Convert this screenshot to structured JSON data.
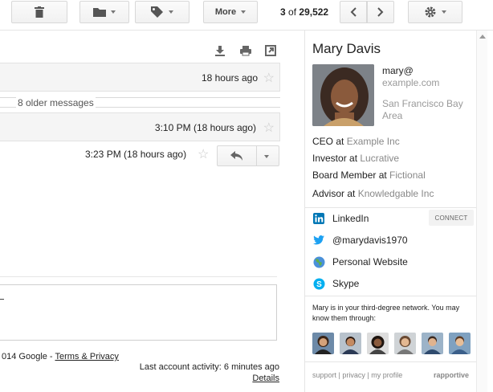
{
  "toolbar": {
    "buttons": [
      {
        "icon": "trash-icon"
      },
      {
        "icon": "folder-icon"
      },
      {
        "icon": "label-icon"
      }
    ],
    "more_label": "More",
    "pager": {
      "current": "3",
      "of_label": "of",
      "total": "29,522"
    },
    "settings_icon": "gear-icon"
  },
  "thread": {
    "util_icons": [
      "download-icon",
      "print-icon",
      "new-window-icon"
    ],
    "first_time": "18 hours ago",
    "older_messages": "8 older messages",
    "second_time": "3:10 PM (18 hours ago)",
    "third_time": "3:23 PM (18 hours ago)",
    "reply_placeholder": "",
    "footer": {
      "copyright": "014 Google - ",
      "terms_link": "Terms & Privacy",
      "last_activity": "Last account activity: 6 minutes ago",
      "details_link": "Details"
    }
  },
  "contact": {
    "name": "Mary Davis",
    "email_user": "mary@",
    "email_domain": "example.com",
    "location": "San Francisco Bay Area",
    "jobs": [
      {
        "role": "CEO at ",
        "org": "Example Inc"
      },
      {
        "role": "Investor at ",
        "org": "Lucrative"
      },
      {
        "role": "Board Member at ",
        "org": "Fictional"
      },
      {
        "role": "Advisor at ",
        "org": "Knowledgable Inc"
      }
    ],
    "links": [
      {
        "icon": "linkedin-icon",
        "label": "LinkedIn"
      },
      {
        "icon": "twitter-icon",
        "label": "@marydavis1970"
      },
      {
        "icon": "globe-icon",
        "label": "Personal Website"
      },
      {
        "icon": "skype-icon",
        "label": "Skype"
      }
    ],
    "connect_label": "CONNECT",
    "network_text": "Mary is in your third-degree network. You may know them through:",
    "footer_links": "support | privacy | my profile",
    "brand": "rapportive"
  },
  "colors": {
    "linkedin": "#0077b5",
    "twitter": "#1da1f2",
    "skype": "#00aff0",
    "org_gray": "#888888"
  }
}
